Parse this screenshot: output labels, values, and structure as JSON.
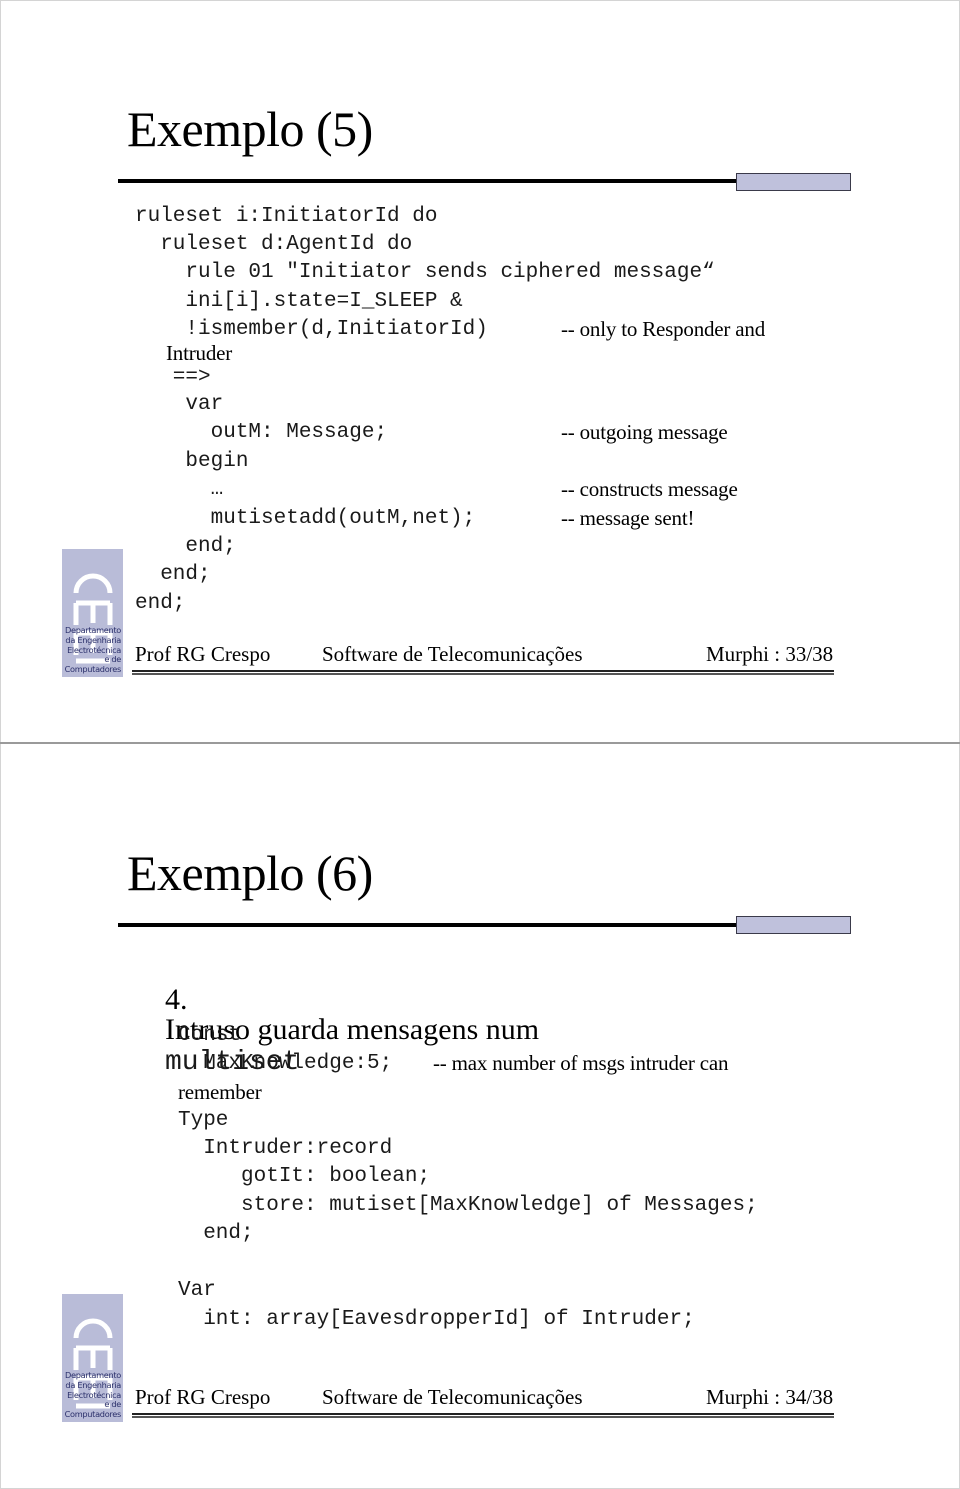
{
  "colors": {
    "accent": "#bfc1dc",
    "logo_bg": "#b9bcd8",
    "logo_text": "#2a2f6a",
    "text": "#000000"
  },
  "logo": {
    "letters": "DEEC",
    "lines": [
      "Departamento",
      "da Engenharia",
      "Electrotécnica",
      "e de",
      "Computadores"
    ]
  },
  "slides": [
    {
      "title": "Exemplo (5)",
      "code_lines": [
        {
          "code": "ruleset i:InitiatorId do",
          "comment": ""
        },
        {
          "code": "  ruleset d:AgentId do",
          "comment": ""
        },
        {
          "code": "    rule 01 \"Initiator sends ciphered message“",
          "comment": ""
        },
        {
          "code": "    ini[i].state=I_SLEEP &",
          "comment": ""
        },
        {
          "code": "    !ismember(d,InitiatorId)",
          "comment": "-- only to Responder and"
        },
        {
          "code": "",
          "comment": "Intruder"
        },
        {
          "code": "   ==>",
          "comment": ""
        },
        {
          "code": "    var",
          "comment": ""
        },
        {
          "code": "      outM: Message;",
          "comment": "-- outgoing message"
        },
        {
          "code": "    begin",
          "comment": ""
        },
        {
          "code": "      …",
          "comment": "-- constructs message"
        },
        {
          "code": "      mutisetadd(outM,net);",
          "comment": "-- message sent!"
        },
        {
          "code": "    end;",
          "comment": ""
        },
        {
          "code": "  end;",
          "comment": ""
        },
        {
          "code": "end;",
          "comment": ""
        }
      ],
      "footer": {
        "author": "Prof RG Crespo",
        "course": "Software de Telecomunicações",
        "page": "Murphi : 33/38"
      }
    },
    {
      "title": "Exemplo (6)",
      "bullet": {
        "number": "4.",
        "text": "Intruso guarda mensagens num",
        "code_term": "multiset"
      },
      "code_lines": [
        {
          "code": "Const",
          "comment": ""
        },
        {
          "code": "  MaxKnowledge:5;",
          "comment": "-- max number of msgs intruder can"
        },
        {
          "code": "",
          "comment": "remember"
        },
        {
          "code": "Type",
          "comment": ""
        },
        {
          "code": "  Intruder:record",
          "comment": ""
        },
        {
          "code": "     gotIt: boolean;",
          "comment": ""
        },
        {
          "code": "     store: mutiset[MaxKnowledge] of Messages;",
          "comment": ""
        },
        {
          "code": "  end;",
          "comment": ""
        },
        {
          "code": "",
          "comment": ""
        },
        {
          "code": "Var",
          "comment": ""
        },
        {
          "code": "  int: array[EavesdropperId] of Intruder;",
          "comment": ""
        }
      ],
      "footer": {
        "author": "Prof RG Crespo",
        "course": "Software de Telecomunicações",
        "page": "Murphi : 34/38"
      }
    }
  ]
}
